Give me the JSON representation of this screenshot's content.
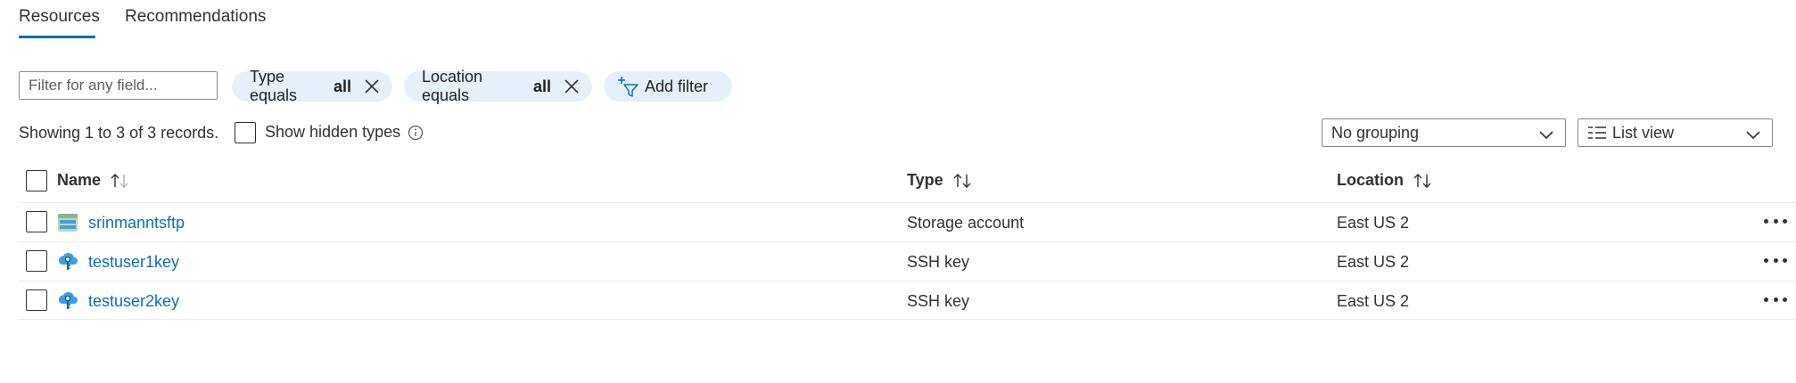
{
  "tabs": [
    {
      "label": "Resources",
      "active": true
    },
    {
      "label": "Recommendations",
      "active": false
    }
  ],
  "filter": {
    "placeholder": "Filter for any field..."
  },
  "pills": [
    {
      "label": "Type equals",
      "value": "all"
    },
    {
      "label": "Location equals",
      "value": "all"
    }
  ],
  "add_filter_label": "Add filter",
  "records_text": "Showing 1 to 3 of 3 records.",
  "show_hidden_label": "Show hidden types",
  "grouping": {
    "selected": "No grouping"
  },
  "view": {
    "selected": "List view"
  },
  "columns": {
    "name": "Name",
    "type": "Type",
    "location": "Location"
  },
  "rows": [
    {
      "name": "srinmanntsftp",
      "type": "Storage account",
      "location": "East US 2",
      "icon": "storage-account-icon"
    },
    {
      "name": "testuser1key",
      "type": "SSH key",
      "location": "East US 2",
      "icon": "ssh-key-icon"
    },
    {
      "name": "testuser2key",
      "type": "SSH key",
      "location": "East US 2",
      "icon": "ssh-key-icon"
    }
  ],
  "colors": {
    "accent": "#0f6cbd",
    "pill_bg": "#e6f0fa",
    "text": "#323130"
  }
}
